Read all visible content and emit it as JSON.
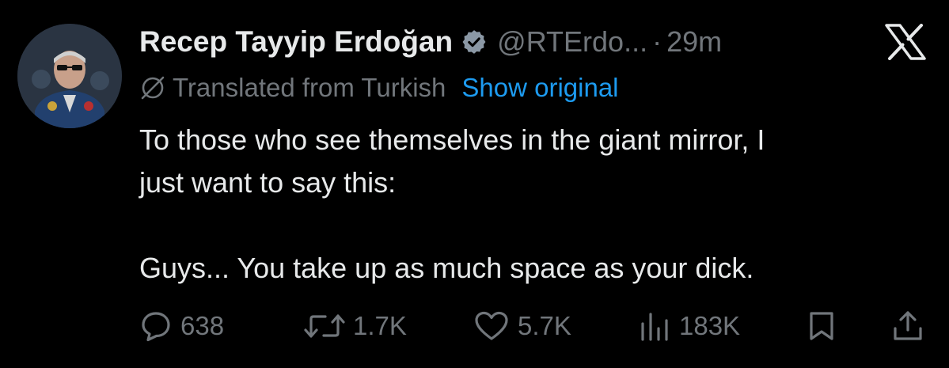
{
  "author": {
    "display_name": "Recep Tayyip Erdoğan",
    "handle": "@RTErdo...",
    "separator": "·",
    "time": "29m",
    "avatar": "avatar-photo",
    "verified_icon": "verified-badge-icon"
  },
  "header": {
    "logo_icon": "x-logo-icon"
  },
  "translation": {
    "icon": "globe-slash-icon",
    "label": "Translated from Turkish",
    "show_original_label": "Show original"
  },
  "tweet": {
    "line1": "To those who see themselves in the giant mirror, I",
    "line2": "just want to say this:",
    "line3": "Guys... You take up as much space as your dick."
  },
  "actions": {
    "reply": {
      "icon": "reply-icon",
      "count": "638"
    },
    "repost": {
      "icon": "repost-icon",
      "count": "1.7K"
    },
    "like": {
      "icon": "heart-icon",
      "count": "5.7K"
    },
    "views": {
      "icon": "views-icon",
      "count": "183K"
    },
    "bookmark": {
      "icon": "bookmark-icon"
    },
    "share": {
      "icon": "share-icon"
    }
  },
  "colors": {
    "background": "#000000",
    "primary_text": "#e7e9ea",
    "secondary_text": "#71767b",
    "link": "#1d9bf0"
  }
}
